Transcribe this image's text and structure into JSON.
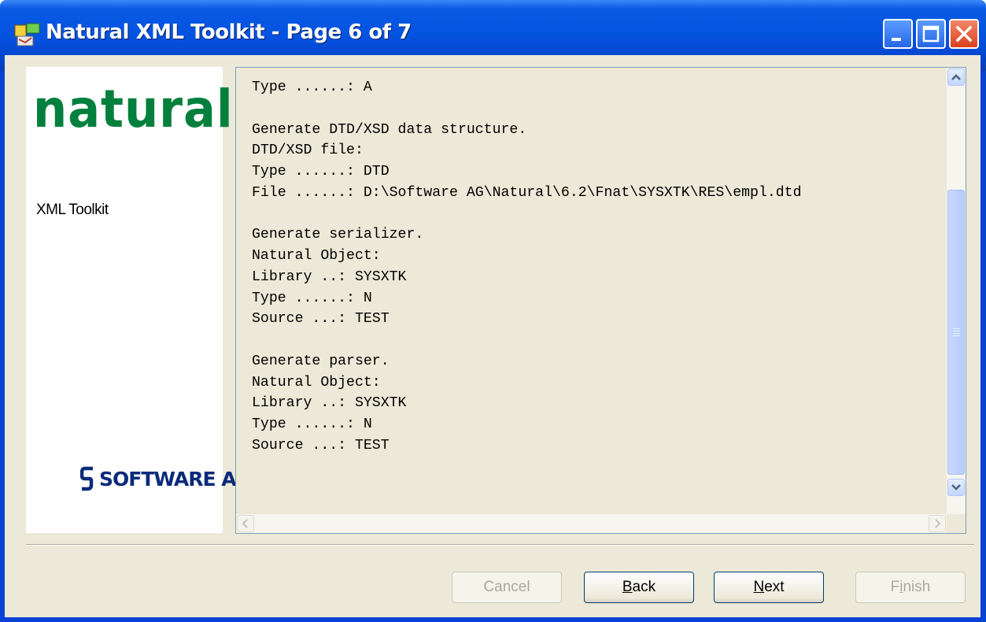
{
  "window": {
    "title": "Natural XML Toolkit - Page 6 of 7",
    "accent_color": "#0453e0",
    "controls": [
      "minimize-icon",
      "maximize-icon",
      "close-icon"
    ]
  },
  "branding": {
    "logo_text": "natural",
    "product": "XML Toolkit",
    "company_logo": "SOFTWARE AG"
  },
  "summary": {
    "lines": [
      "Type ......: A",
      "",
      "Generate DTD/XSD data structure.",
      "DTD/XSD file:",
      "Type ......: DTD",
      "File ......: D:\\Software AG\\Natural\\6.2\\Fnat\\SYSXTK\\RES\\empl.dtd",
      "",
      "Generate serializer.",
      "Natural Object:",
      "Library ..: SYSXTK",
      "Type ......: N",
      "Source ...: TEST",
      "",
      "Generate parser.",
      "Natural Object:",
      "Library ..: SYSXTK",
      "Type ......: N",
      "Source ...: TEST"
    ]
  },
  "buttons": {
    "cancel": {
      "pre": "Cancel",
      "key": "",
      "post": "",
      "enabled": false
    },
    "back": {
      "pre": "",
      "key": "B",
      "post": "ack",
      "enabled": true
    },
    "next": {
      "pre": "",
      "key": "N",
      "post": "ext",
      "enabled": true
    },
    "finish": {
      "pre": "F",
      "key": "i",
      "post": "nish",
      "enabled": false
    }
  }
}
